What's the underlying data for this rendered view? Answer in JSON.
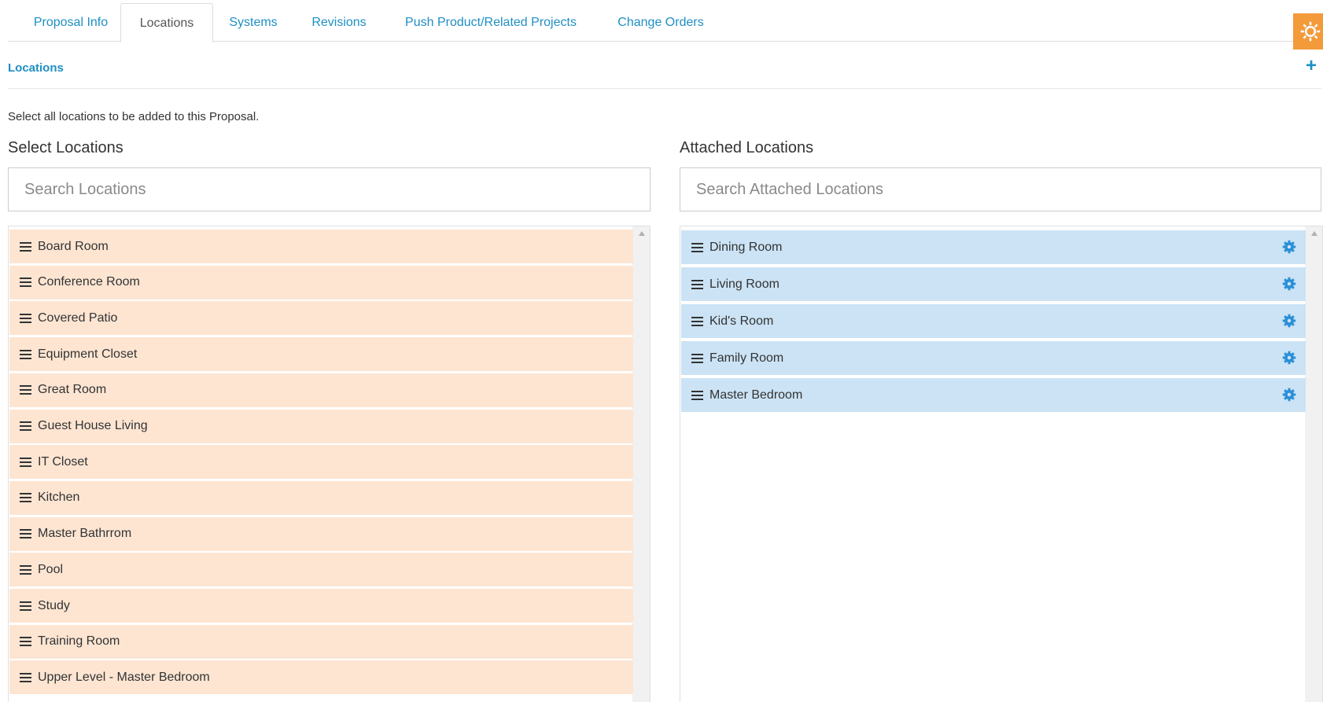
{
  "tabs": [
    {
      "label": "Proposal Info"
    },
    {
      "label": "Locations"
    },
    {
      "label": "Systems"
    },
    {
      "label": "Revisions"
    },
    {
      "label": "Push Product/Related Projects"
    },
    {
      "label": "Change Orders"
    }
  ],
  "active_tab": "Locations",
  "section": {
    "title": "Locations",
    "add_label": "+"
  },
  "instructions": "Select all locations to be added to this Proposal.",
  "select_panel": {
    "title": "Select Locations",
    "search_placeholder": "Search Locations",
    "items": [
      "Board Room",
      "Conference Room",
      "Covered Patio",
      "Equipment Closet",
      "Great Room",
      "Guest House Living",
      "IT Closet",
      "Kitchen",
      "Master Bathrrom",
      "Pool",
      "Study",
      "Training Room",
      "Upper Level - Master Bedroom"
    ]
  },
  "attached_panel": {
    "title": "Attached Locations",
    "search_placeholder": "Search Attached Locations",
    "items": [
      "Dining Room",
      "Living Room",
      "Kid's Room",
      "Family Room",
      "Master Bedroom"
    ]
  },
  "colors": {
    "accent": "#1f8fc4",
    "orange_button": "#f39a3b",
    "available_item_bg": "#fde5d2",
    "attached_item_bg": "#cbe3f5",
    "item_gear": "#2a8fd6"
  },
  "icons": {
    "settings": "gear-icon",
    "drag_handle": "hamburger-icon",
    "add": "plus-icon",
    "item_settings": "gear-icon"
  }
}
